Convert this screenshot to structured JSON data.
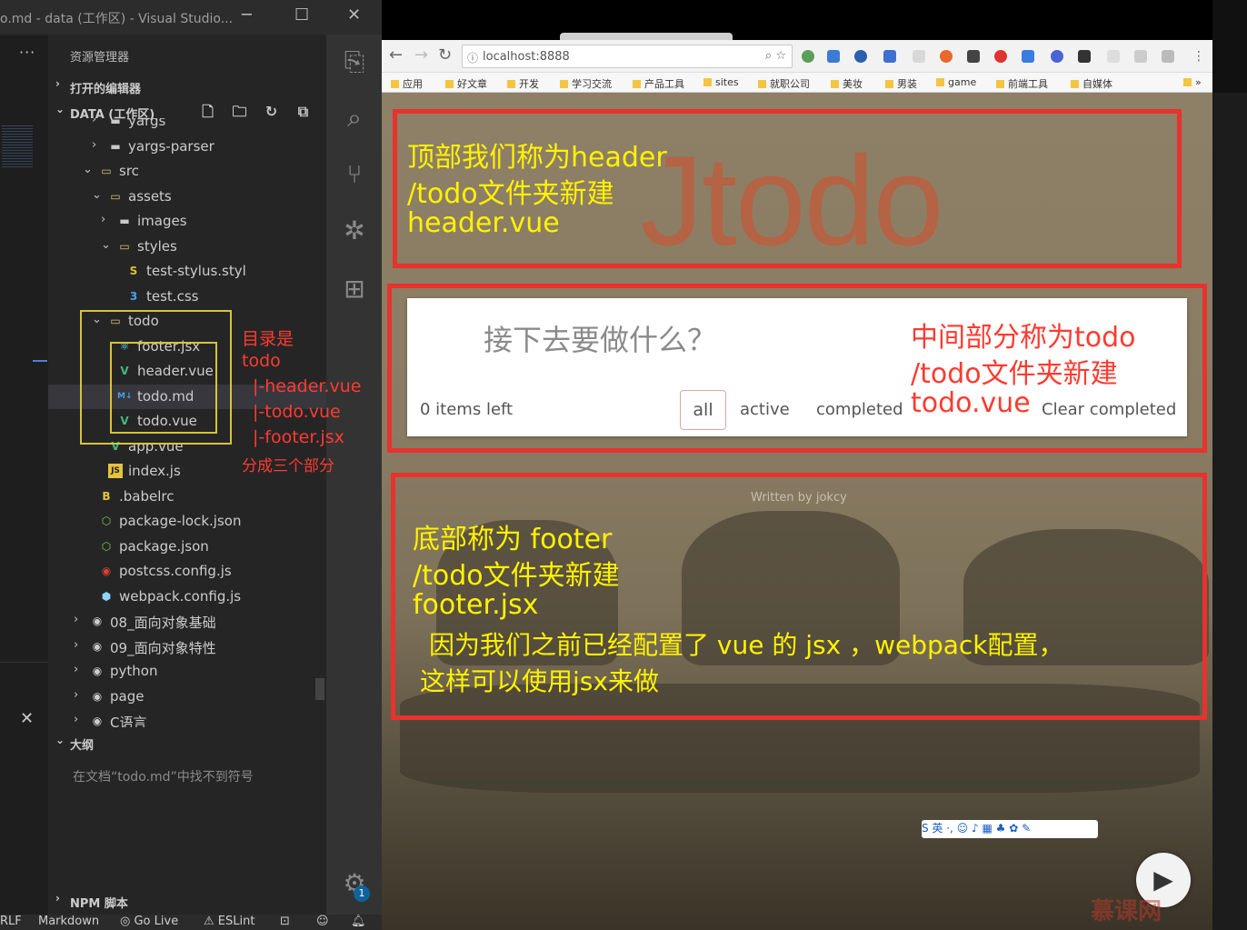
{
  "vscode": {
    "title": "o.md - data (工作区) - Visual Studio...",
    "window_controls": {
      "min": "─",
      "max": "☐",
      "close": "✕"
    },
    "sidebar_header": "资源管理器",
    "more": "···",
    "open_editors": "打开的编辑器",
    "workspace": "DATA (工作区)",
    "tree": [
      {
        "name": "yargs",
        "kind": "folder"
      },
      {
        "name": "yargs-parser",
        "kind": "folder"
      },
      {
        "name": "src",
        "kind": "folder-open"
      },
      {
        "name": "assets",
        "kind": "folder-open"
      },
      {
        "name": "images",
        "kind": "folder"
      },
      {
        "name": "styles",
        "kind": "folder-open"
      },
      {
        "name": "test-stylus.styl",
        "kind": "stylus"
      },
      {
        "name": "test.css",
        "kind": "css"
      },
      {
        "name": "todo",
        "kind": "folder-open"
      },
      {
        "name": "footer.jsx",
        "kind": "react"
      },
      {
        "name": "header.vue",
        "kind": "vue"
      },
      {
        "name": "todo.md",
        "kind": "markdown"
      },
      {
        "name": "todo.vue",
        "kind": "vue"
      },
      {
        "name": "app.vue",
        "kind": "vue"
      },
      {
        "name": "index.js",
        "kind": "js"
      },
      {
        "name": ".babelrc",
        "kind": "babel"
      },
      {
        "name": "package-lock.json",
        "kind": "json"
      },
      {
        "name": "package.json",
        "kind": "json"
      },
      {
        "name": "postcss.config.js",
        "kind": "postcss"
      },
      {
        "name": "webpack.config.js",
        "kind": "webpack"
      },
      {
        "name": "08_面向对象基础",
        "kind": "root"
      },
      {
        "name": "09_面向对象特性",
        "kind": "root"
      },
      {
        "name": "python",
        "kind": "root"
      },
      {
        "name": "page",
        "kind": "root"
      },
      {
        "name": "C语言",
        "kind": "root"
      }
    ],
    "outline": {
      "title": "大纲",
      "message": "在文档“todo.md”中找不到符号"
    },
    "npm_scripts": "NPM 脚本",
    "settings_badge": "1",
    "statusbar": {
      "eol": "RLF",
      "language": "Markdown",
      "golive": "Go Live",
      "eslint": "ESLint"
    },
    "annotation": {
      "line1": "目录是",
      "line2": "todo",
      "line3": "|-header.vue",
      "line4": "|-todo.vue",
      "line5": "|-footer.jsx",
      "line6": "分成三个部分"
    }
  },
  "browser": {
    "url": "localhost:8888",
    "bookmarks": [
      "应用",
      "好文章",
      "开发",
      "学习交流",
      "产品工具",
      "sites",
      "就职公司",
      "美妆",
      "男装",
      "game",
      "前端工具",
      "自媒体"
    ],
    "bookmarks_more": "»",
    "app_title": "Jtodo",
    "header_note": {
      "l1": "顶部我们称为header",
      "l2": "/todo文件夹新建",
      "l3": "header.vue"
    },
    "input_placeholder": "接下去要做什么？",
    "items_left": "0 items left",
    "filters": {
      "all": "all",
      "active": "active",
      "completed": "completed"
    },
    "clear_completed": "Clear completed",
    "todo_note": {
      "l1": "中间部分称为todo",
      "l2": "/todo文件夹新建",
      "l3": "todo.vue"
    },
    "written_by": "Written by jokcy",
    "footer_note": {
      "l1": "底部称为 footer",
      "l2": "/todo文件夹新建",
      "l3": "footer.jsx",
      "l4": "因为我们之前已经配置了 vue 的 jsx ，webpack配置，",
      "l5": "这样可以使用jsx来做"
    },
    "ime_bar": "S 英 ·, ☺ ♪ ▦ ♣ ✿ ✎",
    "watermark": "慕课网"
  },
  "colors": {
    "annotation_red": "#e8322e",
    "annotation_yellow": "#fff200",
    "folder_box": "#d5c43a",
    "vue_green": "#41b883",
    "react_cyan": "#61dafb"
  }
}
